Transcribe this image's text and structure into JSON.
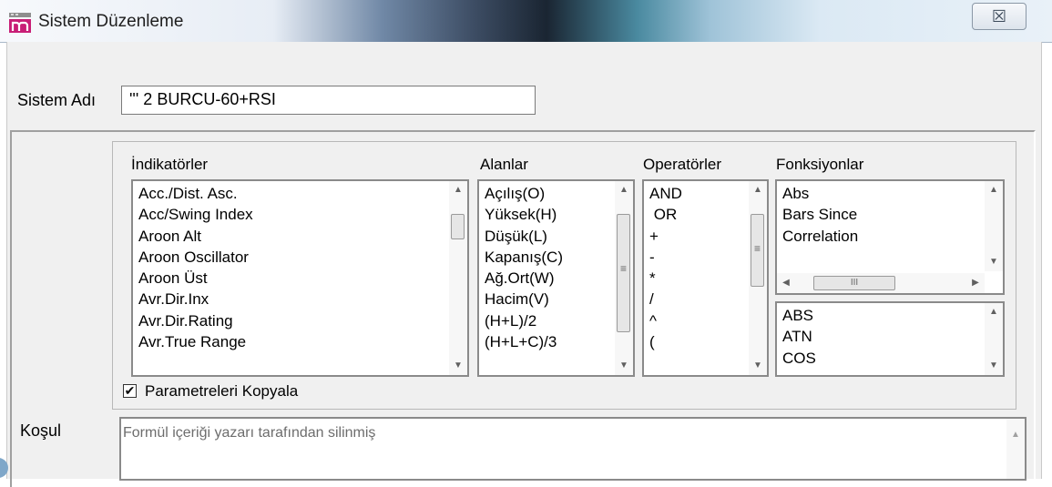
{
  "window": {
    "title": "Sistem Düzenleme",
    "close_label": "☒"
  },
  "form": {
    "system_name_label": "Sistem Adı",
    "system_name_value": "''' 2 BURCU-60+RSI",
    "condition_label": "Koşul",
    "copy_params_label": "Parametreleri Kopyala",
    "copy_params_checked": "✔",
    "formula_text": "Formül içeriği yazarı tarafından silinmiş"
  },
  "lists": {
    "indicators": {
      "header": "İndikatörler",
      "items": [
        "Acc./Dist. Asc.",
        "Acc/Swing Index",
        "Aroon Alt",
        "Aroon Oscillator",
        "Aroon Üst",
        "Avr.Dir.Inx",
        "Avr.Dir.Rating",
        "Avr.True Range"
      ]
    },
    "fields": {
      "header": "Alanlar",
      "items": [
        "Açılış(O)",
        "Yüksek(H)",
        "Düşük(L)",
        "Kapanış(C)",
        "Ağ.Ort(W)",
        "Hacim(V)",
        "(H+L)/2",
        "(H+L+C)/3"
      ]
    },
    "operators": {
      "header": "Operatörler",
      "items": [
        "AND",
        " OR",
        "+",
        "-",
        "*",
        "/",
        "^",
        "("
      ]
    },
    "functions": {
      "header": "Fonksiyonlar",
      "items": [
        "Abs",
        "Bars Since",
        "Correlation"
      ]
    },
    "function_names": {
      "items": [
        "ABS",
        "ATN",
        "COS"
      ]
    }
  },
  "scroll_glyphs": {
    "up": "▲",
    "down": "▼",
    "left": "◀",
    "right": "▶",
    "grip": "≡",
    "hgrip": "III"
  },
  "icons": [
    "app-icon",
    "close-icon",
    "checkbox-check-icon",
    "scroll-arrow-icon"
  ],
  "colors": {
    "title_text": "#1e1e1e",
    "dialog_bg": "#f0f0f0",
    "formula_placeholder": "#6d6d6d"
  }
}
